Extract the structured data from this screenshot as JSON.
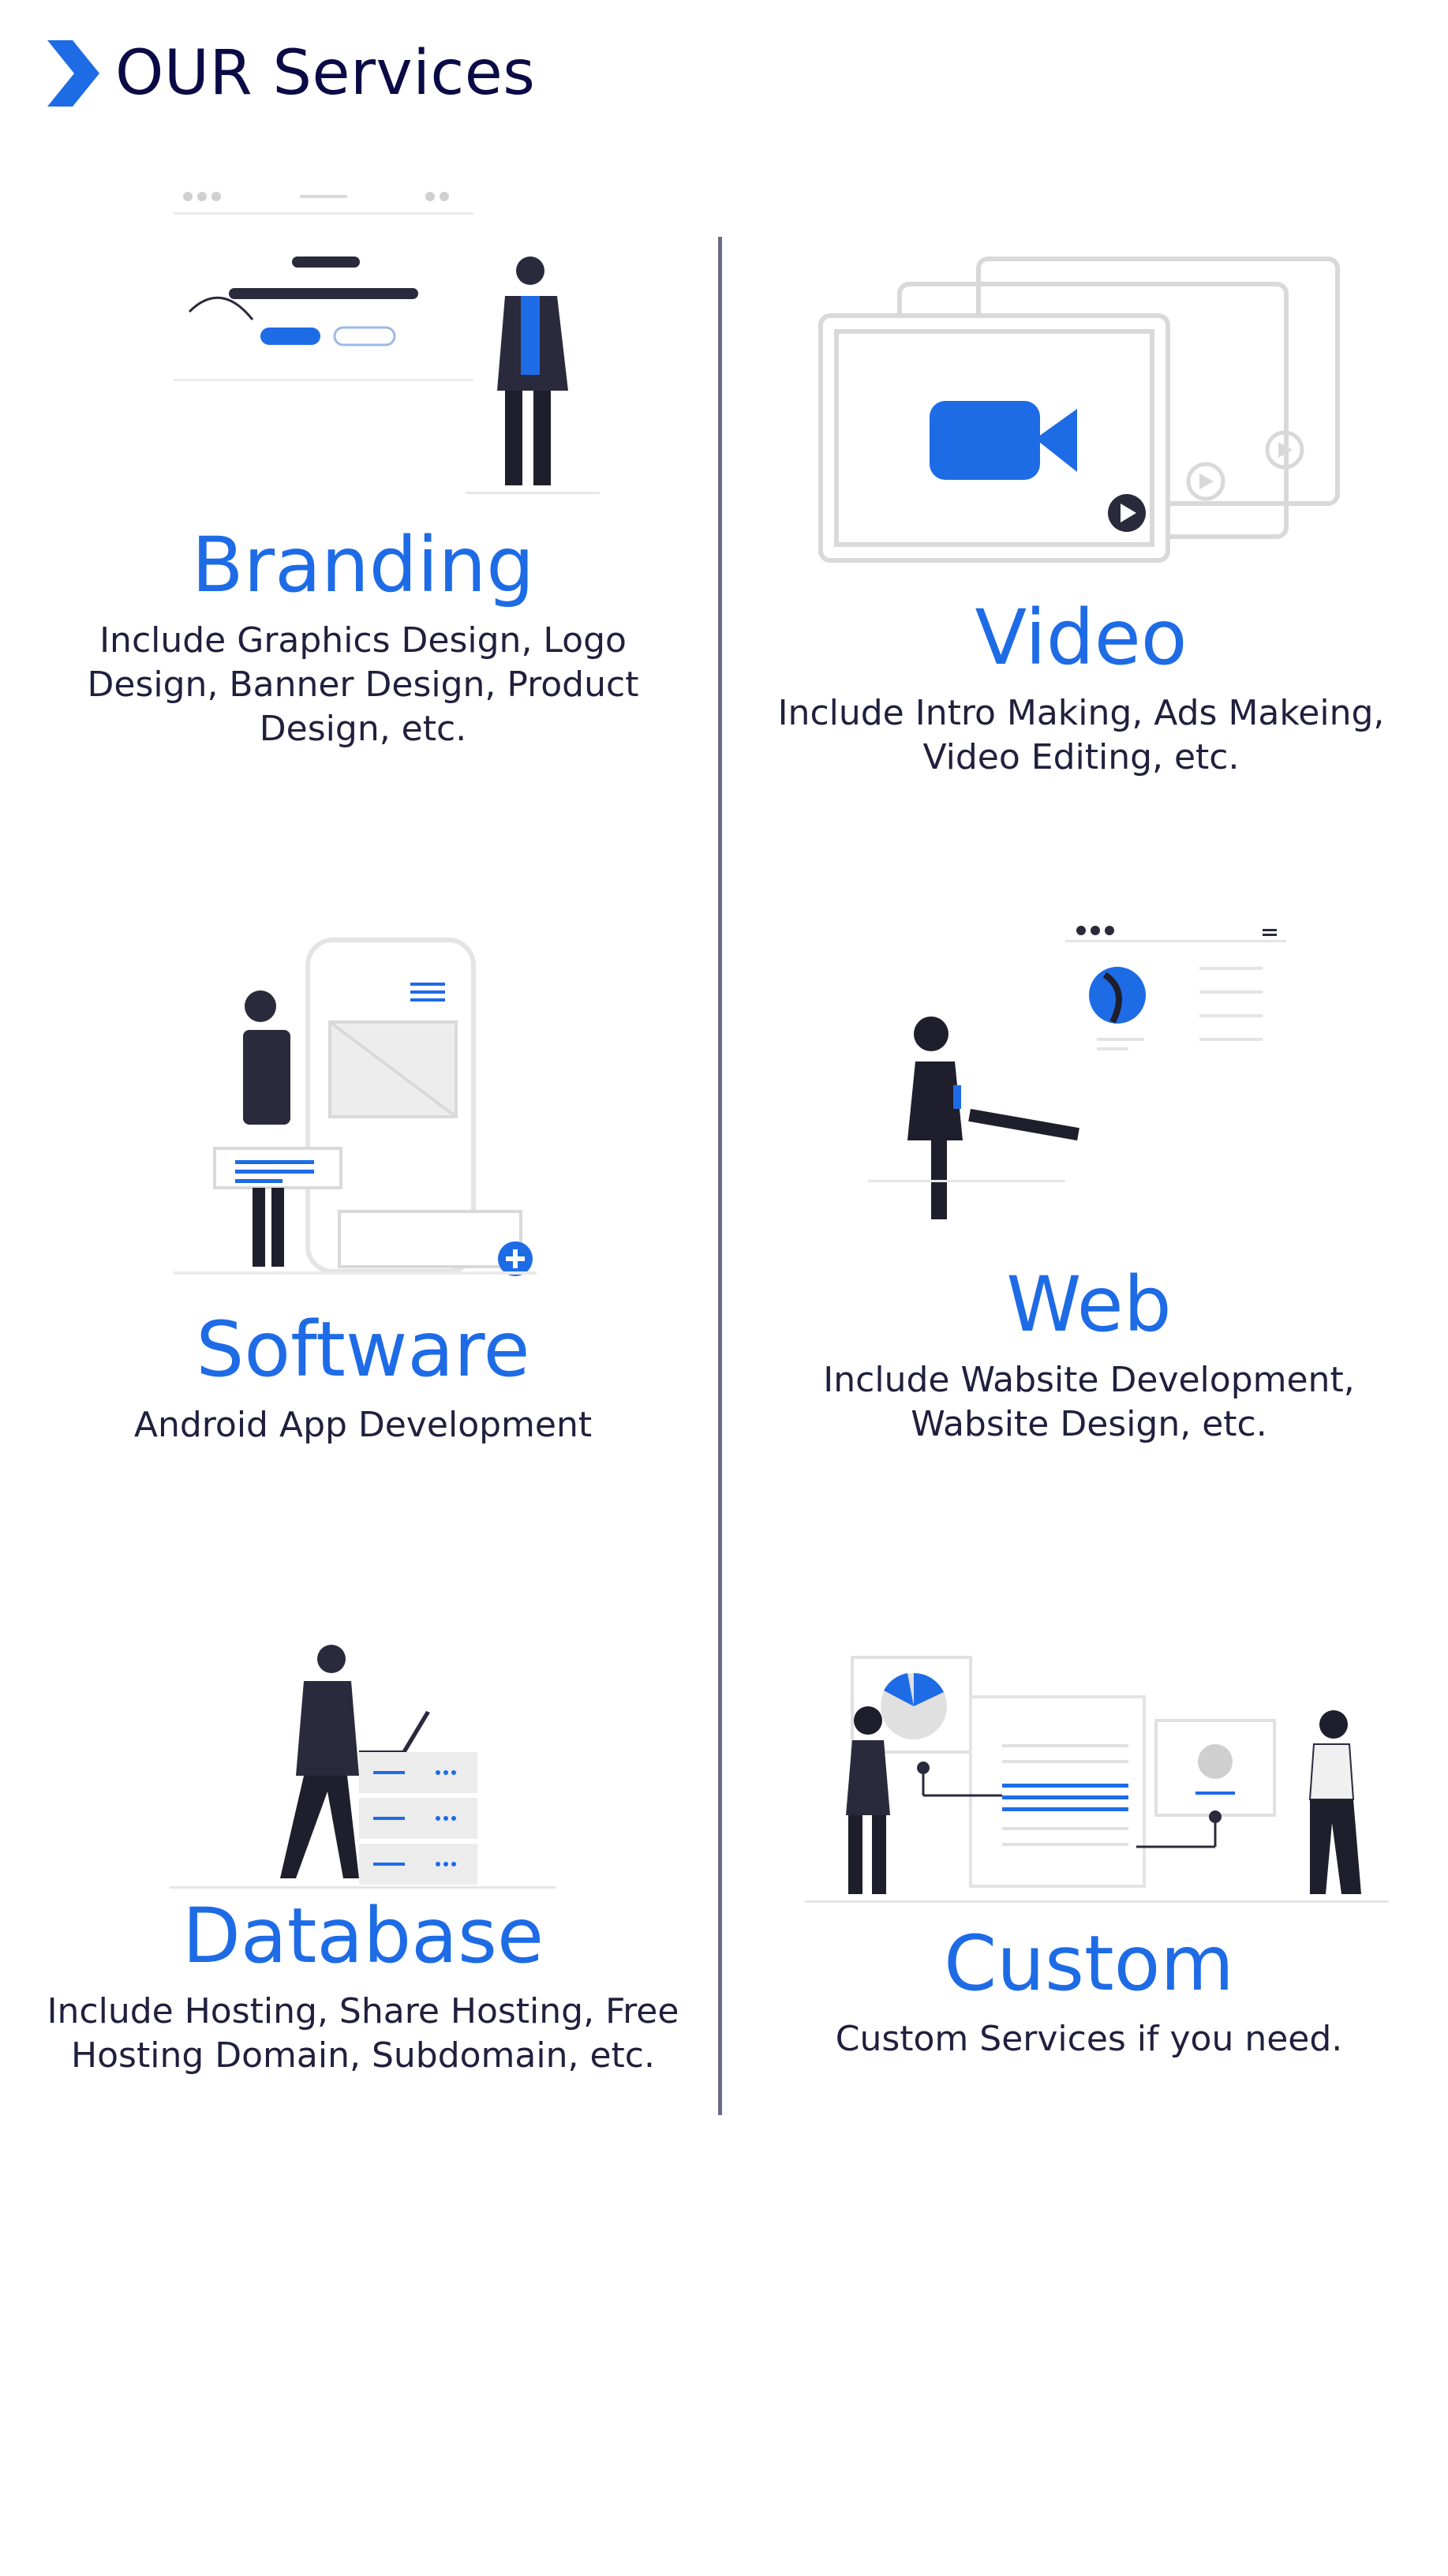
{
  "header": {
    "title": "OUR Services",
    "icon": "chevron-right-icon",
    "accent": "#1e6be6"
  },
  "services": [
    {
      "name": "Branding",
      "description": "Include Graphics Design,  Logo Design,  Banner Design,  Product Design, etc."
    },
    {
      "name": "Video",
      "description": "Include Intro Making,  Ads Makeing, Video Editing, etc."
    },
    {
      "name": "Software",
      "description": "Android App Development"
    },
    {
      "name": "Web",
      "description": "Include Wabsite Development, Wabsite Design, etc."
    },
    {
      "name": "Database",
      "description": "Include Hosting, Share Hosting, Free Hosting Domain, Subdomain, etc."
    },
    {
      "name": "Custom",
      "description": "Custom Services if you need."
    }
  ],
  "colors": {
    "accent": "#1e6be6",
    "text": "#20203e",
    "divider": "#6b6b8a"
  }
}
